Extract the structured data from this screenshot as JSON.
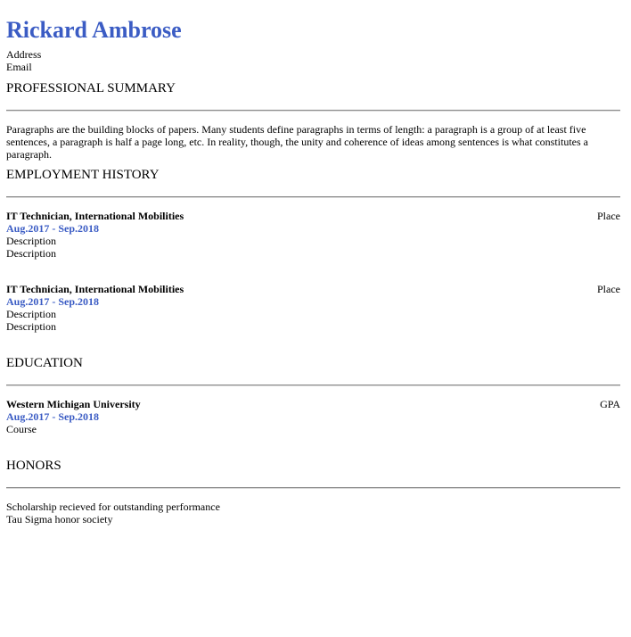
{
  "header": {
    "name": "Rickard Ambrose",
    "address": "Address",
    "email": "Email"
  },
  "summary": {
    "title": "PROFESSIONAL SUMMARY",
    "text": "Paragraphs are the building blocks of papers. Many students define paragraphs in terms of length: a paragraph is a group of at least five sentences, a paragraph is half a page long, etc. In reality, though, the unity and coherence of ideas among sentences is what constitutes a paragraph."
  },
  "employment": {
    "title": "EMPLOYMENT HISTORY",
    "entries": [
      {
        "role": "IT Technician, International Mobilities",
        "place": "Place",
        "dates": "Aug.2017 - Sep.2018",
        "lines": [
          "Description",
          "Description"
        ]
      },
      {
        "role": "IT Technician, International Mobilities",
        "place": "Place",
        "dates": "Aug.2017 - Sep.2018",
        "lines": [
          "Description",
          "Description"
        ]
      }
    ]
  },
  "education": {
    "title": "EDUCATION",
    "entries": [
      {
        "school": "Western Michigan University",
        "gpa": "GPA",
        "dates": "Aug.2017 - Sep.2018",
        "course": "Course"
      }
    ]
  },
  "honors": {
    "title": "HONORS",
    "items": [
      "Scholarship recieved for outstanding performance",
      "Tau Sigma honor society"
    ]
  },
  "colors": {
    "accent": "#3b5cc4",
    "text": "#000000",
    "rule": "#8a8a8a"
  }
}
